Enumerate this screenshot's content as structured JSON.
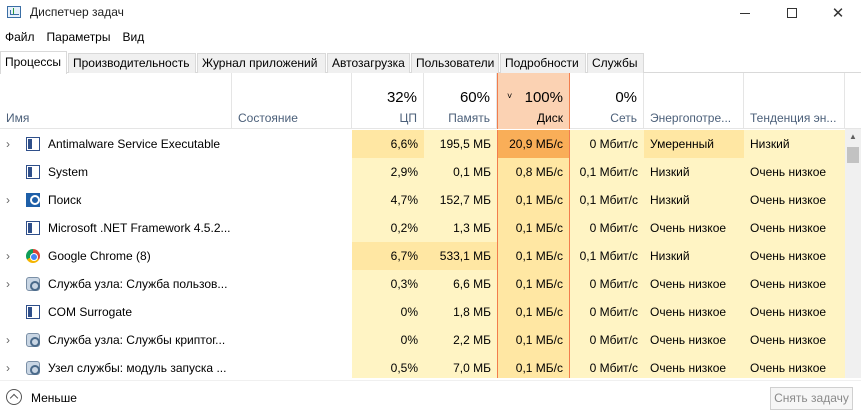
{
  "window": {
    "title": "Диспетчер задач"
  },
  "menu": [
    "Файл",
    "Параметры",
    "Вид"
  ],
  "tabs": [
    "Процессы",
    "Производительность",
    "Журнал приложений",
    "Автозагрузка",
    "Пользователи",
    "Подробности",
    "Службы"
  ],
  "active_tab": 0,
  "columns": {
    "name": {
      "label": "Имя"
    },
    "status": {
      "label": "Состояние"
    },
    "cpu": {
      "label": "ЦП",
      "pct": "32%"
    },
    "memory": {
      "label": "Память",
      "pct": "60%"
    },
    "disk": {
      "label": "Диск",
      "pct": "100%",
      "sorted": true
    },
    "network": {
      "label": "Сеть",
      "pct": "0%"
    },
    "energy": {
      "label": "Энергопотре..."
    },
    "energy_trend": {
      "label": "Тенденция эн..."
    }
  },
  "rows": [
    {
      "name": "Antimalware Service Executable",
      "icon": "window-icon",
      "expandable": true,
      "status": "",
      "cpu": "6,6%",
      "memory": "195,5 МБ",
      "disk": "20,9 МБ/с",
      "network": "0 Мбит/с",
      "energy": "Умеренный",
      "energy_trend": "Низкий"
    },
    {
      "name": "System",
      "icon": "window-icon",
      "expandable": false,
      "status": "",
      "cpu": "2,9%",
      "memory": "0,1 МБ",
      "disk": "0,8 МБ/с",
      "network": "0,1 Мбит/с",
      "energy": "Низкий",
      "energy_trend": "Очень низкое"
    },
    {
      "name": "Поиск",
      "icon": "search-icon",
      "expandable": true,
      "status": "",
      "cpu": "4,7%",
      "memory": "152,7 МБ",
      "disk": "0,1 МБ/с",
      "network": "0,1 Мбит/с",
      "energy": "Низкий",
      "energy_trend": "Очень низкое"
    },
    {
      "name": "Microsoft .NET Framework 4.5.2...",
      "icon": "window-icon",
      "expandable": false,
      "status": "",
      "cpu": "0,2%",
      "memory": "1,3 МБ",
      "disk": "0,1 МБ/с",
      "network": "0 Мбит/с",
      "energy": "Очень низкое",
      "energy_trend": "Очень низкое"
    },
    {
      "name": "Google Chrome (8)",
      "icon": "chrome-icon",
      "expandable": true,
      "status": "",
      "cpu": "6,7%",
      "memory": "533,1 МБ",
      "disk": "0,1 МБ/с",
      "network": "0,1 Мбит/с",
      "energy": "Низкий",
      "energy_trend": "Очень низкое"
    },
    {
      "name": "Служба узла: Служба пользов...",
      "icon": "gear-icon",
      "expandable": true,
      "status": "",
      "cpu": "0,3%",
      "memory": "6,6 МБ",
      "disk": "0,1 МБ/с",
      "network": "0 Мбит/с",
      "energy": "Очень низкое",
      "energy_trend": "Очень низкое"
    },
    {
      "name": "COM Surrogate",
      "icon": "window-icon",
      "expandable": false,
      "status": "",
      "cpu": "0%",
      "memory": "1,8 МБ",
      "disk": "0,1 МБ/с",
      "network": "0 Мбит/с",
      "energy": "Очень низкое",
      "energy_trend": "Очень низкое"
    },
    {
      "name": "Служба узла: Службы криптог...",
      "icon": "gear-icon",
      "expandable": true,
      "status": "",
      "cpu": "0%",
      "memory": "2,2 МБ",
      "disk": "0,1 МБ/с",
      "network": "0 Мбит/с",
      "energy": "Очень низкое",
      "energy_trend": "Очень низкое"
    },
    {
      "name": "Узел службы: модуль запуска ...",
      "icon": "gear-icon",
      "expandable": true,
      "status": "",
      "cpu": "0,5%",
      "memory": "7,0 МБ",
      "disk": "0,1 МБ/с",
      "network": "0 Мбит/с",
      "energy": "Очень низкое",
      "energy_trend": "Очень низкое"
    }
  ],
  "footer": {
    "less_label": "Меньше",
    "end_task_label": "Снять задачу"
  },
  "colors": {
    "heat_light": "#fff4c4",
    "heat_medium": "#ffe7a3",
    "heat_high": "#f9ae58",
    "sorted_header": "#fbd2b3",
    "sorted_border": "#f27d4d"
  }
}
